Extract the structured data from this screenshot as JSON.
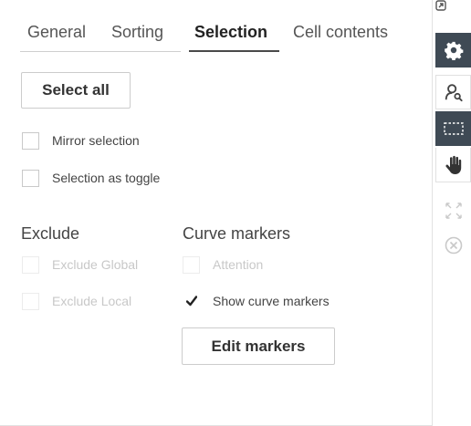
{
  "tabs": [
    {
      "label": "General",
      "active": false
    },
    {
      "label": "Sorting",
      "active": false
    },
    {
      "label": "Selection",
      "active": true
    },
    {
      "label": "Cell contents",
      "active": false
    }
  ],
  "selection": {
    "select_all_label": "Select all",
    "mirror_selection": {
      "label": "Mirror selection",
      "checked": false
    },
    "selection_as_toggle": {
      "label": "Selection as toggle",
      "checked": false
    }
  },
  "exclude": {
    "title": "Exclude",
    "global": {
      "label": "Exclude Global",
      "checked": false,
      "disabled": true
    },
    "local": {
      "label": "Exclude Local",
      "checked": false,
      "disabled": true
    }
  },
  "curve_markers": {
    "title": "Curve markers",
    "attention": {
      "label": "Attention",
      "checked": false,
      "disabled": true
    },
    "show": {
      "label": "Show curve markers",
      "checked": true
    },
    "edit_label": "Edit markers"
  },
  "toolbar": {
    "items": [
      {
        "icon": "gear-icon",
        "active": true
      },
      {
        "icon": "person-search-icon",
        "active": false
      },
      {
        "icon": "rectangle-select-icon",
        "active": true
      },
      {
        "icon": "hand-pan-icon",
        "active": false
      },
      {
        "icon": "expand-arrows-icon",
        "active": false
      },
      {
        "icon": "close-circle-icon",
        "active": false
      }
    ]
  },
  "colors": {
    "dark_toolbar": "#3f4a55",
    "text": "#333333",
    "disabled_text": "#c8c8c8"
  }
}
